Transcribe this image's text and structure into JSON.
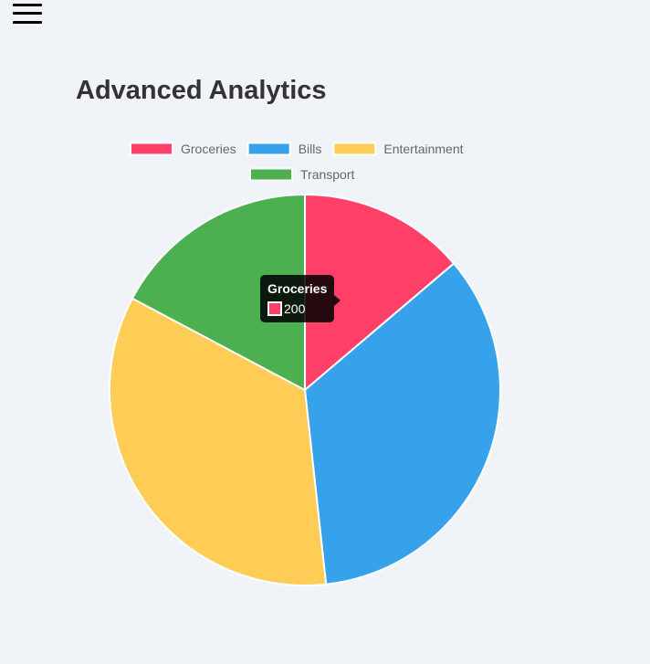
{
  "header": {
    "menu_icon": "hamburger-menu-icon",
    "title": "Advanced Analytics"
  },
  "colors": {
    "background": "#f0f4f8",
    "Groceries": "#ff4069",
    "Bills": "#36a2eb",
    "Entertainment": "#ffcd56",
    "Transport": "#4caf50"
  },
  "chart_data": {
    "type": "pie",
    "categories": [
      "Groceries",
      "Bills",
      "Entertainment",
      "Transport"
    ],
    "values": [
      200,
      500,
      500,
      250
    ],
    "legend_position": "top",
    "tooltip": {
      "title": "Groceries",
      "value": "200"
    }
  }
}
